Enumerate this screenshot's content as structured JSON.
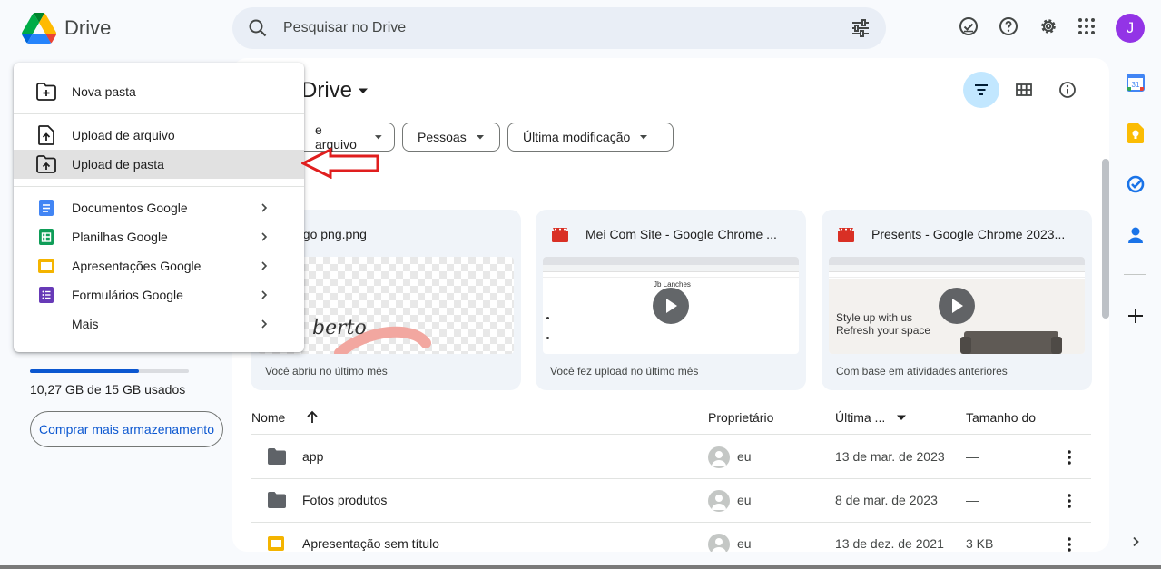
{
  "app": {
    "name": "Drive"
  },
  "search": {
    "placeholder": "Pesquisar no Drive"
  },
  "header": {
    "avatar_letter": "J"
  },
  "storage": {
    "used_text": "10,27 GB de 15 GB usados",
    "used_fraction": 0.685,
    "buy_label": "Comprar mais armazenamento"
  },
  "main": {
    "title": "Drive",
    "filters": [
      "e arquivo",
      "Pessoas",
      "Última modificação"
    ],
    "suggested": [
      {
        "title": "ogo png.png",
        "subtitle": "Você abriu no último mês"
      },
      {
        "title": "Mei Com Site - Google Chrome ...",
        "subtitle": "Você fez upload no último mês"
      },
      {
        "title": "Presents - Google Chrome 2023...",
        "subtitle": "Com base em atividades anteriores"
      }
    ],
    "thumb_texts": {
      "logo_script": "berto",
      "lanches": "Jb Lanches",
      "style_line1": "Style up with us",
      "style_line2": "Refresh your space"
    },
    "columns": {
      "name": "Nome",
      "owner": "Proprietário",
      "modified": "Última ...",
      "size": "Tamanho do"
    },
    "rows": [
      {
        "name": "app",
        "owner": "eu",
        "modified": "13 de mar. de 2023",
        "size": "—"
      },
      {
        "name": "Fotos produtos",
        "owner": "eu",
        "modified": "8 de mar. de 2023",
        "size": "—"
      },
      {
        "name": "Apresentação sem título",
        "owner": "eu",
        "modified": "13 de dez. de 2021",
        "size": "3 KB"
      }
    ]
  },
  "menu": {
    "items": [
      {
        "label": "Nova pasta"
      },
      {
        "label": "Upload de arquivo"
      },
      {
        "label": "Upload de pasta"
      },
      {
        "label": "Documentos Google"
      },
      {
        "label": "Planilhas Google"
      },
      {
        "label": "Apresentações Google"
      },
      {
        "label": "Formulários Google"
      },
      {
        "label": "Mais"
      }
    ]
  },
  "side_panel": {
    "calendar_day": "31"
  },
  "colors": {
    "accent": "#0b57d0",
    "docs": "#4285f4",
    "sheets": "#0f9d58",
    "slides": "#f4b400",
    "forms": "#673ab7",
    "annotation_arrow": "#e01e1e"
  }
}
